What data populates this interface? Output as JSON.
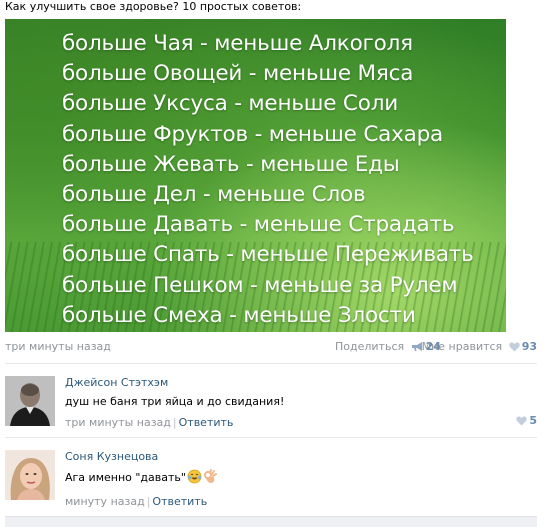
{
  "post": {
    "title": "Как улучшить свое здоровье? 10 простых советов:",
    "image_lines": [
      "больше Чая - меньше Алкоголя",
      "больше Овощей - меньше Мяса",
      "больше Уксуса - меньше Соли",
      "больше Фруктов - меньше Сахара",
      "больше Жевать - меньше Еды",
      "больше Дел - меньше Слов",
      "больше Давать - меньше  Страдать",
      "больше Спать - меньше Переживать",
      "больше Пешком - меньше за Рулем",
      "больше Смеха - меньше Злости"
    ],
    "time": "три минуты назад",
    "share_label": "Поделиться",
    "share_count": "24",
    "like_label": "Мне нравится",
    "like_count": "93"
  },
  "comments": [
    {
      "author": "Джейсон Стэтхэм",
      "text": "душ не баня три яйца и до свидания!",
      "time": "три минуты назад",
      "reply_label": "Ответить",
      "like_count": "5"
    },
    {
      "author": "Соня Кузнецова",
      "text": "Ага именно \"давать\"",
      "time": "минуту назад",
      "reply_label": "Ответить"
    }
  ],
  "icons": {
    "share": "megaphone-icon",
    "like": "heart-icon"
  },
  "colors": {
    "link": "#2b587a",
    "meta": "#909499",
    "counter": "#6a8bb0",
    "poster_green": "#3f8f2c"
  }
}
